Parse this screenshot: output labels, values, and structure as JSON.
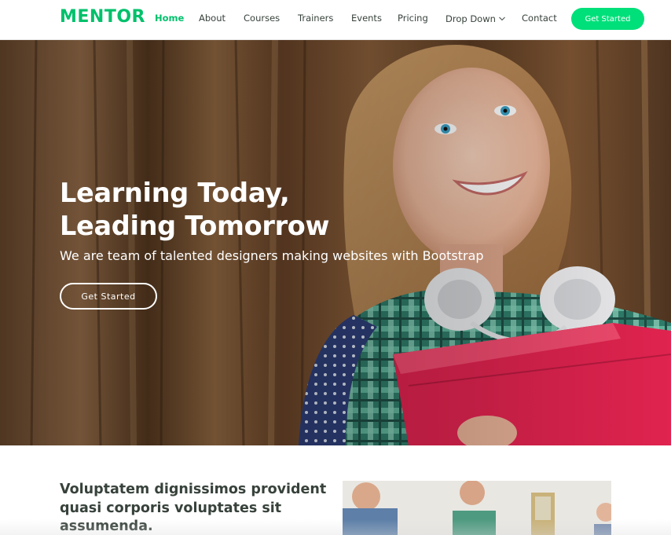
{
  "header": {
    "logo": "MENTOR",
    "nav": [
      {
        "label": "Home",
        "active": true
      },
      {
        "label": "About"
      },
      {
        "label": "Courses"
      },
      {
        "label": "Trainers"
      },
      {
        "label": "Events"
      },
      {
        "label": "Pricing"
      },
      {
        "label": "Drop Down",
        "has_dropdown": true
      },
      {
        "label": "Contact"
      }
    ],
    "cta_label": "Get Started"
  },
  "hero": {
    "title_line1": "Learning Today,",
    "title_line2": "Leading Tomorrow",
    "subtitle": "We are team of talented designers making websites with Bootstrap",
    "cta_label": "Get Started"
  },
  "about": {
    "heading": "Voluptatem dignissimos provident quasi corporis voluptates sit assumenda."
  },
  "colors": {
    "accent": "#00c06b",
    "button": "#00e07a",
    "text": "#37423b"
  }
}
